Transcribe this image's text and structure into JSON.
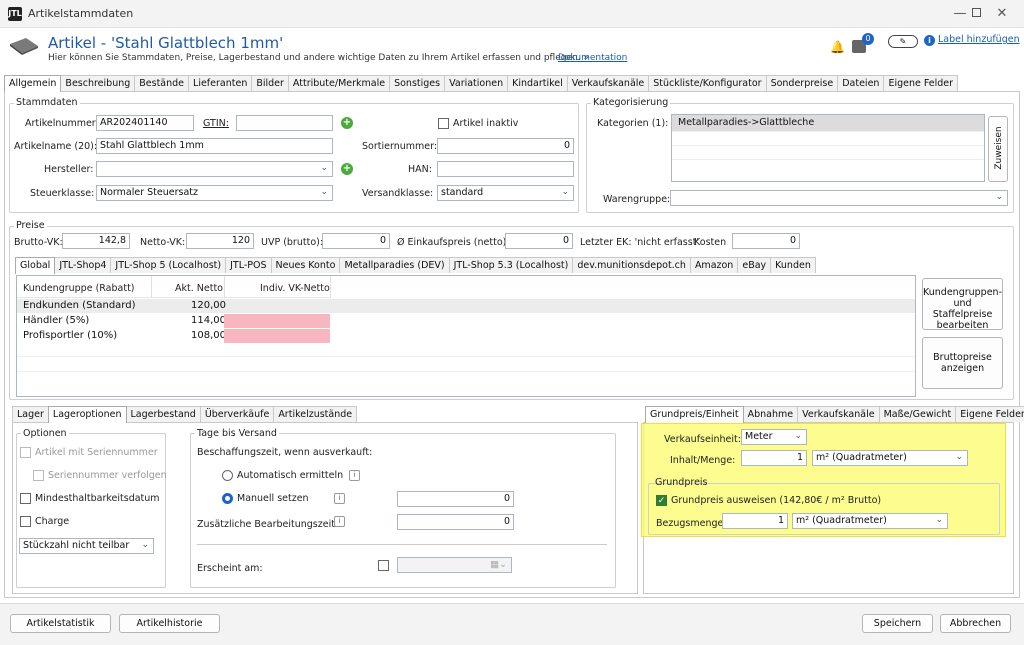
{
  "window": {
    "title": "Artikelstammdaten",
    "logo": "JTL"
  },
  "header": {
    "title": "Artikel - 'Stahl Glattblech 1mm'",
    "subtitle": "Hier können Sie Stammdaten, Preise, Lagerbestand und andere wichtige Daten zu Ihrem Artikel erfassen und pflegen.",
    "sep": "»",
    "doc_link": "Dokumentation",
    "label_link": "Label hinzufügen",
    "badge": "0"
  },
  "main_tabs": [
    "Allgemein",
    "Beschreibung",
    "Bestände",
    "Lieferanten",
    "Bilder",
    "Attribute/Merkmale",
    "Sonstiges",
    "Variationen",
    "Kindartikel",
    "Verkaufskanäle",
    "Stückliste/Konfigurator",
    "Sonderpreise",
    "Dateien",
    "Eigene Felder"
  ],
  "stamm": {
    "legend": "Stammdaten",
    "artnr_label": "Artikelnummer:",
    "artnr": "AR202401140",
    "gtin_label": "GTIN:",
    "gtin": "",
    "inaktiv_label": "Artikel inaktiv",
    "name_label": "Artikelname (20):",
    "name": "Stahl Glattblech 1mm",
    "sort_label": "Sortiernummer:",
    "sort": "0",
    "hersteller_label": "Hersteller:",
    "hersteller": "",
    "han_label": "HAN:",
    "han": "",
    "steuer_label": "Steuerklasse:",
    "steuer": "Normaler Steuersatz",
    "versand_label": "Versandklasse:",
    "versand": "standard"
  },
  "kat": {
    "legend": "Kategorisierung",
    "label": "Kategorien (1):",
    "items": [
      "Metallparadies->Glattbleche"
    ],
    "zuweisen": "Zuweisen",
    "waren_label": "Warengruppe:",
    "waren": ""
  },
  "preise": {
    "legend": "Preise",
    "brutto_label": "Brutto-VK:",
    "brutto": "142,8",
    "netto_label": "Netto-VK:",
    "netto": "120",
    "uvp_label": "UVP (brutto):",
    "uvp": "0",
    "ek_label": "Ø Einkaufspreis (netto):",
    "ek": "0",
    "letzter_label": "Letzter EK: 'nicht erfasst'",
    "kosten_label": "Kosten",
    "kosten": "0"
  },
  "shop_tabs": [
    "Global",
    "JTL-Shop4",
    "JTL-Shop 5 (Localhost)",
    "JTL-POS",
    "Neues Konto",
    "Metallparadies (DEV)",
    "JTL-Shop 5.3 (Localhost)",
    "dev.munitionsdepot.ch",
    "Amazon",
    "eBay",
    "Kunden"
  ],
  "grid": {
    "headers": [
      "Kundengruppe (Rabatt)",
      "Akt. Netto",
      "Indiv. VK-Netto"
    ],
    "rows": [
      {
        "group": "Endkunden (Standard)",
        "netto": "120,00"
      },
      {
        "group": "Händler (5%)",
        "netto": "114,00"
      },
      {
        "group": "Profisportler (10%)",
        "netto": "108,00"
      }
    ]
  },
  "side_buttons": {
    "kundengruppen": "Kundengruppen- und Staffelpreise bearbeiten",
    "brutto": "Bruttopreise anzeigen"
  },
  "lager_tabs": [
    "Lager",
    "Lageroptionen",
    "Lagerbestand",
    "Überverkäufe",
    "Artikelzustände"
  ],
  "optionen": {
    "legend": "Optionen",
    "serien": "Artikel mit Seriennummer",
    "verfolgen": "Seriennummer verfolgen",
    "mhd": "Mindesthaltbarkeitsdatum",
    "charge": "Charge",
    "teilbar": "Stückzahl nicht teilbar"
  },
  "tage": {
    "legend": "Tage bis Versand",
    "beschaffung": "Beschaffungszeit, wenn ausverkauft:",
    "auto": "Automatisch ermitteln",
    "manuell": "Manuell setzen",
    "manuell_val": "0",
    "bearbeitung": "Zusätzliche Bearbeitungszeit",
    "bearbeitung_val": "0",
    "erscheint": "Erscheint am:"
  },
  "gp_tabs": [
    "Grundpreis/Einheit",
    "Abnahme",
    "Verkaufskanäle",
    "Maße/Gewicht",
    "Eigene Felder"
  ],
  "gp": {
    "vk_einheit_label": "Verkaufseinheit:",
    "vk_einheit": "Meter",
    "inhalt_label": "Inhalt/Menge:",
    "inhalt": "1",
    "inhalt_unit": "m² (Quadratmeter)",
    "legend": "Grundpreis",
    "ausweisen": "Grundpreis ausweisen (142,80€ / m² Brutto)",
    "bezug_label": "Bezugsmenge",
    "bezug": "1",
    "bezug_unit": "m² (Quadratmeter)"
  },
  "footer": {
    "statistik": "Artikelstatistik",
    "historie": "Artikelhistorie",
    "speichern": "Speichern",
    "abbrechen": "Abbrechen"
  }
}
